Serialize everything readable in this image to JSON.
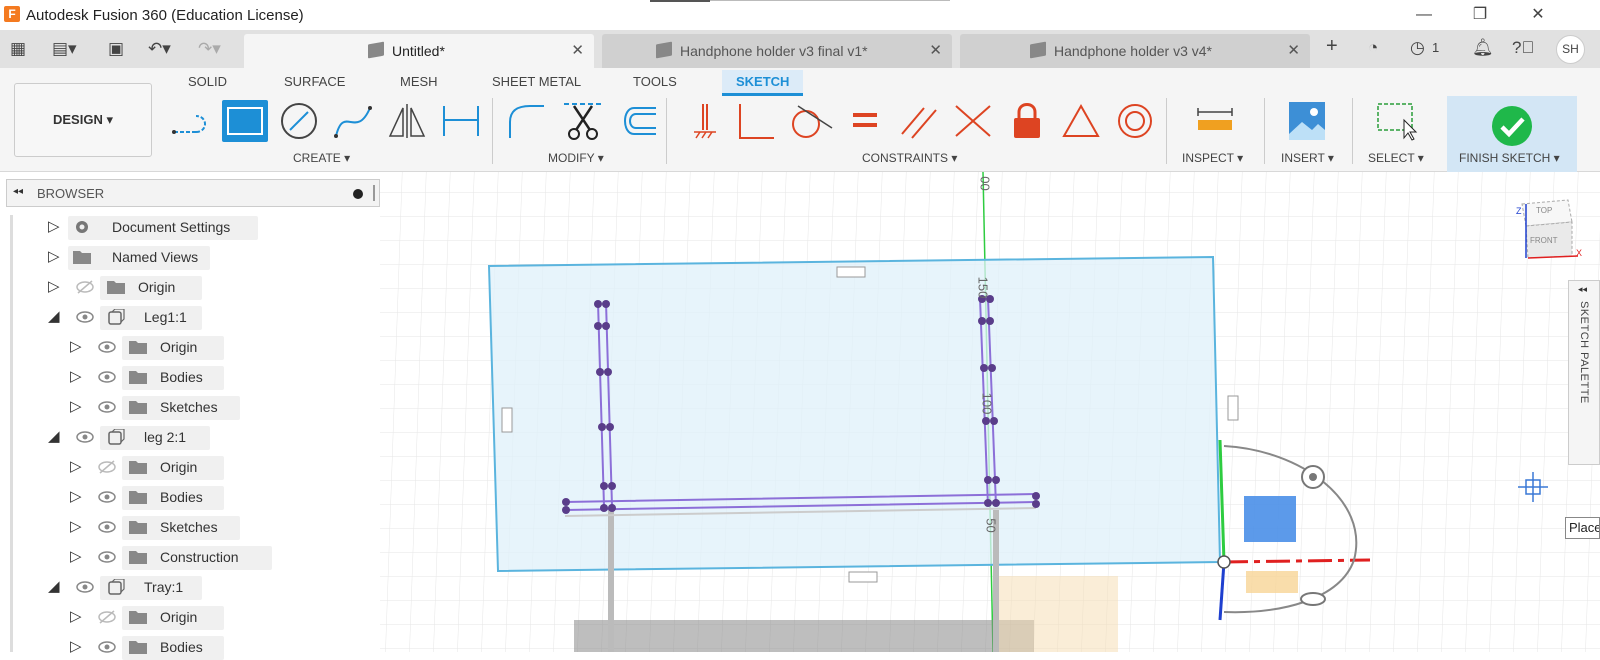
{
  "app": {
    "logo_letter": "F",
    "title": "Autodesk Fusion 360 (Education License)"
  },
  "window_controls": {
    "minimize": "—",
    "restore": "❐",
    "close": "✕"
  },
  "tabs": [
    {
      "label": "Untitled*",
      "active": true
    },
    {
      "label": "Handphone holder v3 final v1*",
      "active": false
    },
    {
      "label": "Handphone holder v3 v4*",
      "active": false
    }
  ],
  "tab_close_glyph": "✕",
  "new_tab_glyph": "+",
  "job_count": "1",
  "user_initials": "SH",
  "workspace": {
    "label": "DESIGN ▾"
  },
  "ribbon_tabs": [
    "SOLID",
    "SURFACE",
    "MESH",
    "SHEET METAL",
    "TOOLS",
    "SKETCH"
  ],
  "active_ribbon_tab": "SKETCH",
  "groups": {
    "create": "CREATE ▾",
    "modify": "MODIFY ▾",
    "constraints": "CONSTRAINTS ▾",
    "inspect": "INSPECT ▾",
    "insert": "INSERT ▾",
    "select": "SELECT ▾",
    "finish": "FINISH SKETCH ▾"
  },
  "browser": {
    "header": "BROWSER",
    "collapse_glyph": "◂◂",
    "items": [
      {
        "label": "Document Settings",
        "icon": "gear-icon",
        "expanded": false,
        "visible": null
      },
      {
        "label": "Named Views",
        "icon": "folder-icon",
        "expanded": false,
        "visible": null
      },
      {
        "label": "Origin",
        "icon": "folder-icon",
        "expanded": false,
        "visible": false
      },
      {
        "label": "Leg1:1",
        "icon": "component-icon",
        "expanded": true,
        "visible": true
      },
      {
        "label": "Origin",
        "icon": "folder-icon",
        "expanded": false,
        "visible": true
      },
      {
        "label": "Bodies",
        "icon": "folder-icon",
        "expanded": false,
        "visible": true
      },
      {
        "label": "Sketches",
        "icon": "folder-icon",
        "expanded": false,
        "visible": true
      },
      {
        "label": "leg 2:1",
        "icon": "component-icon",
        "expanded": true,
        "visible": true
      },
      {
        "label": "Origin",
        "icon": "folder-icon",
        "expanded": false,
        "visible": false
      },
      {
        "label": "Bodies",
        "icon": "folder-icon",
        "expanded": false,
        "visible": true
      },
      {
        "label": "Sketches",
        "icon": "folder-icon",
        "expanded": false,
        "visible": true
      },
      {
        "label": "Construction",
        "icon": "folder-icon",
        "expanded": false,
        "visible": true
      },
      {
        "label": "Tray:1",
        "icon": "component-icon",
        "expanded": true,
        "visible": true
      },
      {
        "label": "Origin",
        "icon": "folder-icon",
        "expanded": false,
        "visible": false
      },
      {
        "label": "Bodies",
        "icon": "folder-icon",
        "expanded": false,
        "visible": true
      }
    ]
  },
  "viewport": {
    "ruler_labels": [
      "00",
      "150",
      "100",
      "50"
    ],
    "viewcube": {
      "top": "TOP",
      "front": "FRONT",
      "z": "Z",
      "x": "X"
    }
  },
  "sketch_palette": {
    "label": "SKETCH PALETTE",
    "collapse_glyph": "◂◂"
  },
  "tooltip": "Place",
  "colors": {
    "accent": "#1d8fd6",
    "finish_green": "#1fb84a",
    "sketch_plane": "#dff0fa",
    "sketch_outline": "#5ab4de",
    "sketch_line": "#8c6fd8",
    "axis_green": "#2ecc40",
    "axis_red": "#e02020",
    "axis_blue": "#1e3fcf"
  }
}
